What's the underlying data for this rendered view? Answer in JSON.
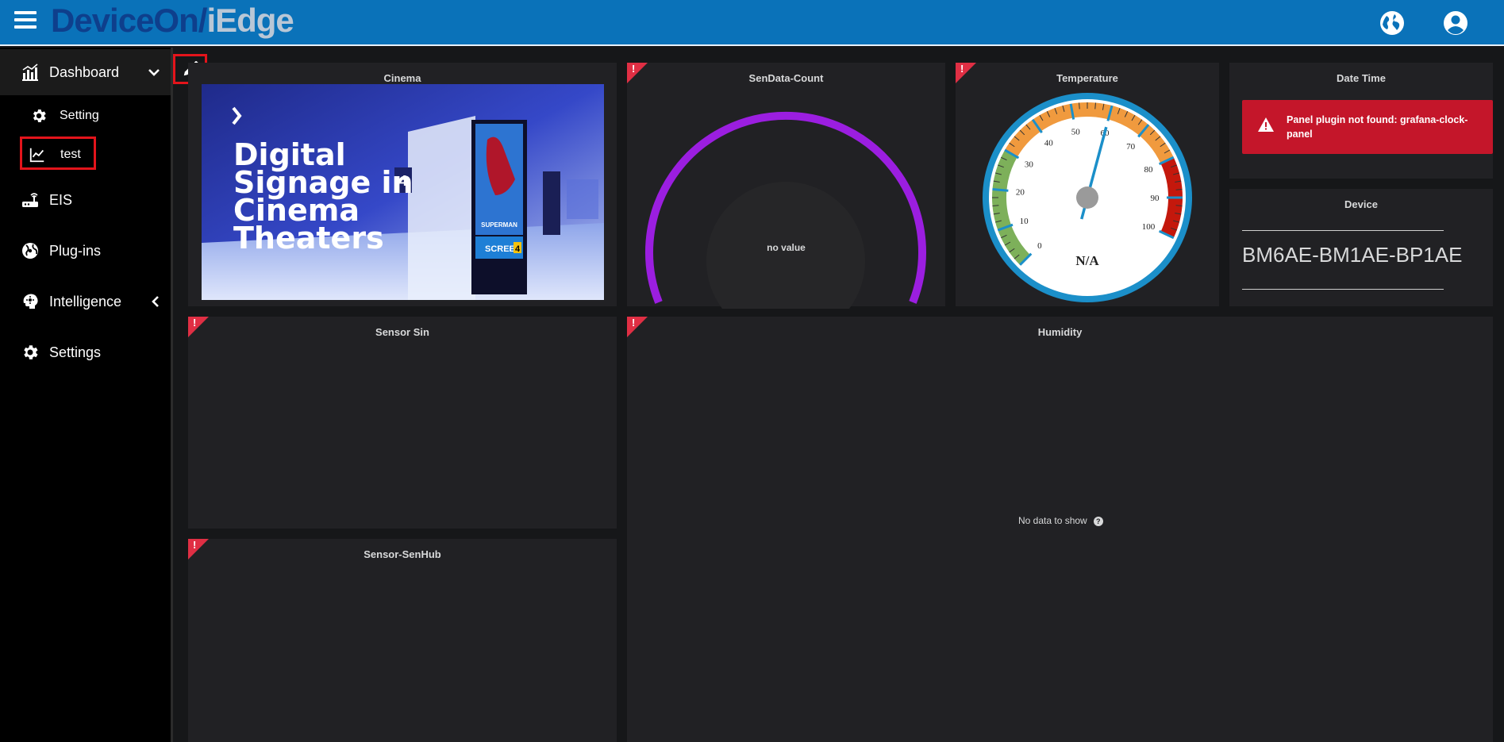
{
  "app": {
    "brand_left": "DeviceOn/",
    "brand_right": "iEdge"
  },
  "header": {
    "icons": [
      "menu-icon",
      "globe-icon",
      "account-icon"
    ]
  },
  "sidebar": {
    "items": [
      {
        "label": "Dashboard",
        "icon": "bar-chart-icon"
      },
      {
        "label": "Setting",
        "icon": "gear-icon"
      },
      {
        "label": "test",
        "icon": "line-chart-icon"
      },
      {
        "label": "EIS",
        "icon": "router-icon"
      },
      {
        "label": "Plug-ins",
        "icon": "plugin-icon"
      },
      {
        "label": "Intelligence",
        "icon": "brain-icon"
      },
      {
        "label": "Settings",
        "icon": "gear-icon"
      }
    ]
  },
  "panels": {
    "cinema": {
      "title": "Cinema",
      "headline": [
        "Digital",
        "Signage in",
        "Cinema",
        "Theaters"
      ],
      "hall_number": "4",
      "poster_title": "SUPERMAN",
      "screen_label": "SCREEN",
      "screen_number": "4"
    },
    "sendata": {
      "title": "SenData-Count",
      "value_text": "no value"
    },
    "temperature": {
      "title": "Temperature",
      "readout": "N/A",
      "ticks": [
        "0",
        "10",
        "20",
        "30",
        "40",
        "50",
        "60",
        "70",
        "80",
        "90",
        "100"
      ],
      "needle_value": 60
    },
    "datetime": {
      "title": "Date Time",
      "alert": "Panel plugin not found: grafana-clock-panel"
    },
    "device": {
      "title": "Device",
      "value": "BM6AE-BM1AE-BP1AE"
    },
    "sensor_sin": {
      "title": "Sensor Sin"
    },
    "humidity": {
      "title": "Humidity",
      "no_data": "No data to show",
      "help": "?"
    },
    "sensor_senhub": {
      "title": "Sensor-SenHub"
    },
    "alert_marker": "!"
  },
  "colors": {
    "header": "#0a72b9",
    "alert": "#c4162a",
    "error_corner": "#e02f44",
    "gauge_arc": "#9b1ee0",
    "gauge_rim": "#1b8fc9"
  }
}
